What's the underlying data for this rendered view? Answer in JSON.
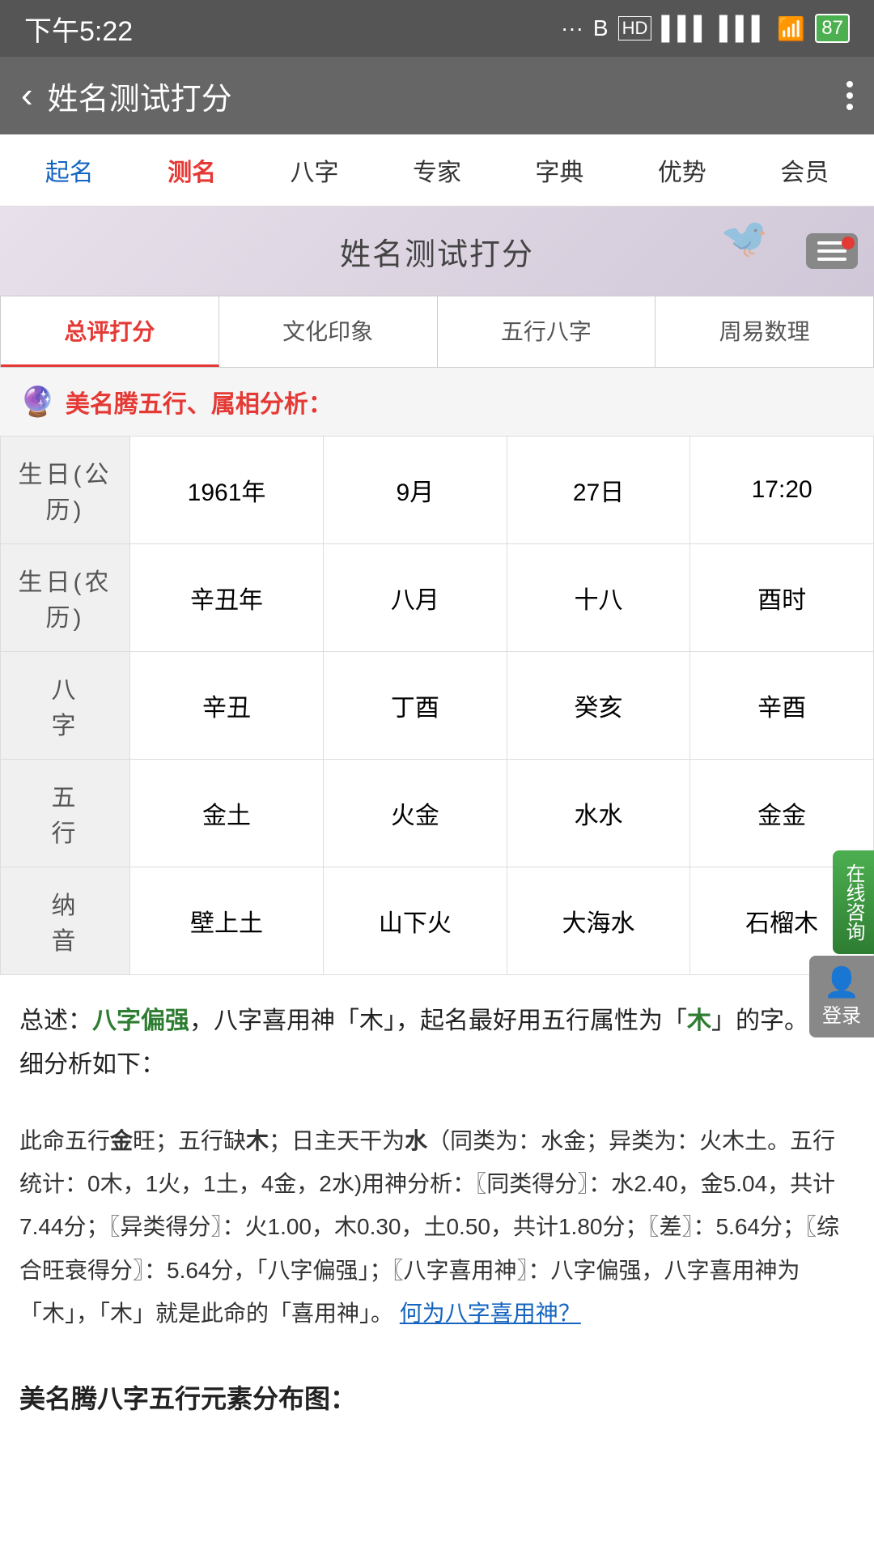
{
  "statusBar": {
    "time": "下午5:22",
    "battery": "87"
  },
  "toolbar": {
    "backLabel": "‹",
    "title": "姓名测试打分",
    "moreLabel": "⋮"
  },
  "navTabs": [
    {
      "id": "qiming",
      "label": "起名",
      "active": false,
      "blue": true
    },
    {
      "id": "cename",
      "label": "测名",
      "active": true,
      "blue": false
    },
    {
      "id": "bazi",
      "label": "八字",
      "active": false,
      "blue": false
    },
    {
      "id": "zhuanjia",
      "label": "专家",
      "active": false,
      "blue": false
    },
    {
      "id": "zidian",
      "label": "字典",
      "active": false,
      "blue": false
    },
    {
      "id": "youshi",
      "label": "优势",
      "active": false,
      "blue": false
    },
    {
      "id": "huiyuan",
      "label": "会员",
      "active": false,
      "blue": false
    }
  ],
  "pageBanner": {
    "title": "姓名测试打分"
  },
  "contentTabs": [
    {
      "id": "zongping",
      "label": "总评打分",
      "active": true
    },
    {
      "id": "wenhua",
      "label": "文化印象",
      "active": false
    },
    {
      "id": "wuxing",
      "label": "五行八字",
      "active": false
    },
    {
      "id": "zhouyi",
      "label": "周易数理",
      "active": false
    }
  ],
  "sectionHeader": {
    "icon": "🔮",
    "text": "美名腾五行、属相分析："
  },
  "tableRows": [
    {
      "label": "生日(公历)",
      "values": [
        "1961年",
        "9月",
        "27日",
        "17:20"
      ]
    },
    {
      "label": "生日(农历)",
      "values": [
        "辛丑年",
        "八月",
        "十八",
        "酉时"
      ]
    },
    {
      "label": "八　　字",
      "values": [
        "辛丑",
        "丁酉",
        "癸亥",
        "辛酉"
      ]
    },
    {
      "label": "五　　行",
      "values": [
        "金土",
        "火金",
        "水水",
        "金金"
      ]
    },
    {
      "label": "纳　　音",
      "values": [
        "壁上土",
        "山下火",
        "大海水",
        "石榴木"
      ]
    }
  ],
  "summaryText": {
    "prefix": "总述：",
    "highlight1": "八字偏强",
    "middle": "，八字喜用神「木」，起名最好用五行属性为「",
    "highlight2": "木",
    "suffix": "」的字。详细分析如下："
  },
  "detailText": "此命五行金旺；五行缺木；日主天干为水（同类为：水金；异类为：火木土。五行统计：0木，1火，1土，4金，2水)用神分析：〖同类得分〗：水2.40，金5.04，共计7.44分；〖异类得分〗：火1.00，木0.30，土0.50，共计1.80分；〖差〗：5.64分；〖综合旺衰得分〗：5.64分，「八字偏强」；〖八字喜用神〗：八字偏强，八字喜用神为「木」，「木」就是此命的「喜用神」。",
  "detailLink": "何为八字喜用神？",
  "bottomSectionHeader": "美名腾八字五行元素分布图：",
  "floatConsult": "在线咨询",
  "floatLogin": "登录"
}
